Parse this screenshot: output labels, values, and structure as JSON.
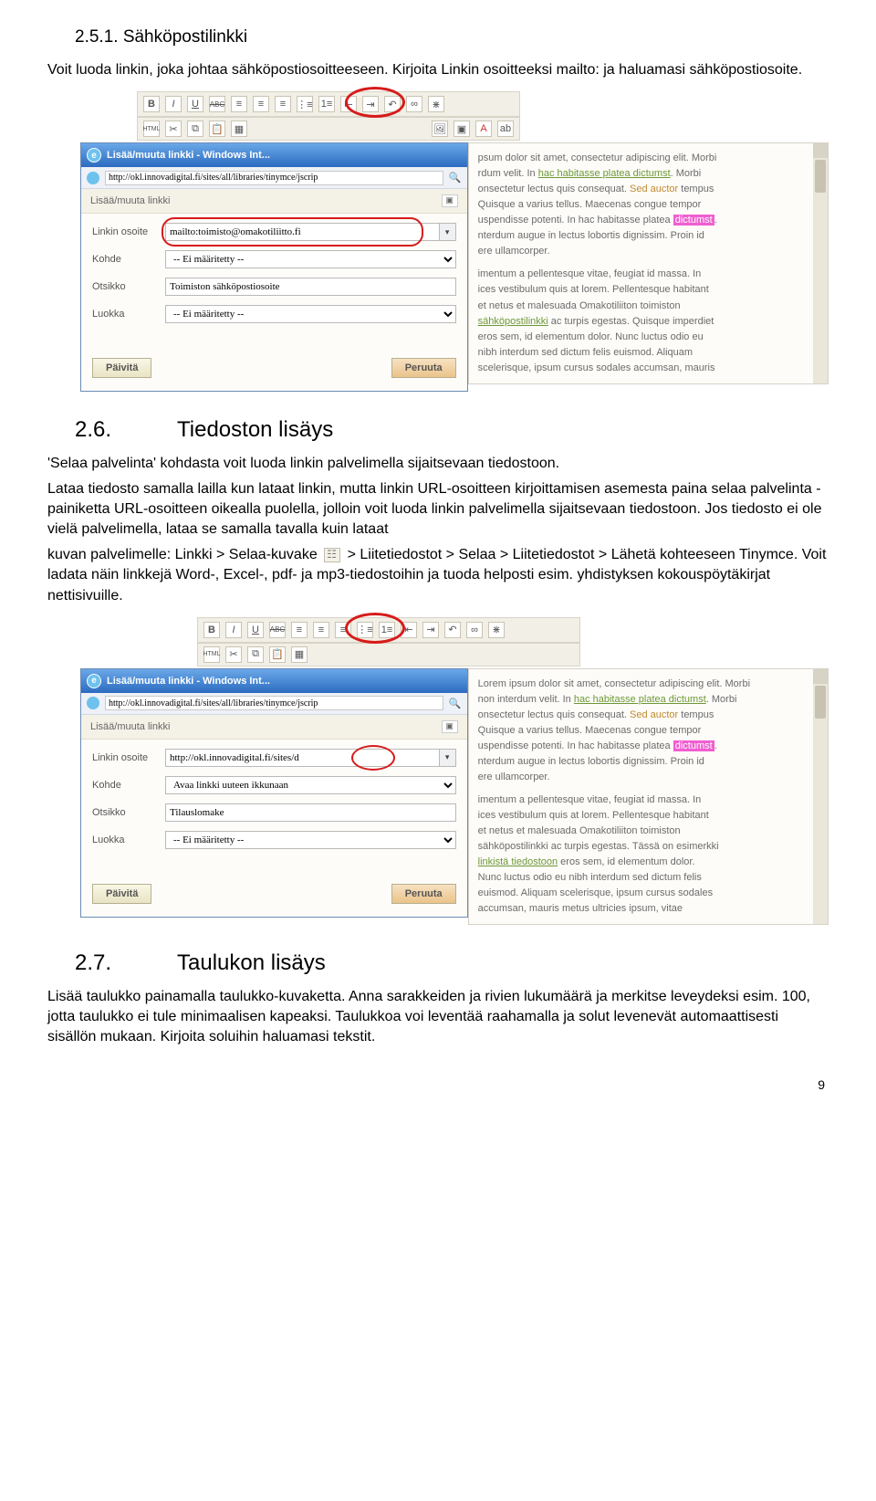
{
  "sec251": {
    "heading": "2.5.1. Sähköpostilinkki",
    "p": "Voit luoda linkin, joka johtaa sähköpostiosoitteeseen. Kirjoita Linkin osoitteeksi mailto: ja haluamasi sähköpostiosoite."
  },
  "sec26": {
    "num": "2.6.",
    "title": "Tiedoston lisäys",
    "p1": "'Selaa palvelinta' kohdasta voit luoda linkin palvelimella sijaitsevaan tiedostoon.",
    "p2": "Lataa tiedosto samalla lailla kun lataat linkin, mutta linkin URL-osoitteen kirjoittamisen asemesta paina selaa palvelinta -painiketta URL-osoitteen oikealla puolella, jolloin voit luoda linkin palvelimella sijaitsevaan tiedostoon. Jos tiedosto ei ole vielä palvelimella, lataa se samalla tavalla kuin lataat",
    "p3a": "kuvan palvelimelle: Linkki > Selaa-kuvake ",
    "p3b": " > Liitetiedostot > Selaa > Liitetiedostot > Lähetä kohteeseen Tinymce. Voit ladata näin linkkejä Word-, Excel-, pdf- ja mp3-tiedostoihin ja tuoda helposti esim. yhdistyksen kokouspöytäkirjat nettisivuille."
  },
  "sec27": {
    "num": "2.7.",
    "title": "Taulukon lisäys",
    "p": "Lisää taulukko painamalla taulukko-kuvaketta. Anna sarakkeiden ja rivien lukumäärä ja merkitse leveydeksi esim. 100, jotta taulukko ei tule minimaalisen kapeaksi. Taulukkoa voi leventää raahamalla ja solut levenevät automaattisesti sisällön mukaan. Kirjoita soluihin haluamasi tekstit."
  },
  "fig_dialog": {
    "win_title": "Lisää/muuta linkki - Windows Int...",
    "url_prefix": "http://okl.innovadigital.fi/sites/all/libraries/tinymce/jscrip",
    "tab": "Lisää/muuta linkki",
    "labels": {
      "url": "Linkin osoite",
      "kohde": "Kohde",
      "otsikko": "Otsikko",
      "luokka": "Luokka"
    },
    "ei_maar": "-- Ei määritetty --",
    "avaa_uuteen": "Avaa linkki uuteen ikkunaan",
    "update": "Päivitä",
    "cancel": "Peruuta"
  },
  "fig1": {
    "url_value": "mailto:toimisto@omakotiliitto.fi",
    "otsikko": "Toimiston sähköpostiosoite"
  },
  "fig2": {
    "url_value": "http://okl.innovadigital.fi/sites/d",
    "otsikko": "Tilauslomake"
  },
  "lorem": {
    "l1a": "psum dolor sit amet, consectetur adipiscing elit. Morbi",
    "l1b": "rdum velit. In ",
    "hac": "hac habitasse platea dictumst",
    "l1c": ". Morbi",
    "l2": "onsectetur lectus quis consequat. ",
    "sed": "Sed auctor",
    "l2b": " tempus",
    "l3": "Quisque a varius tellus. Maecenas congue tempor",
    "l4a": "uspendisse potenti. In hac habitasse platea ",
    "dict": "dictumst",
    "l4b": ".",
    "l5": "nterdum augue in lectus lobortis dignissim. Proin id",
    "l6": "ere ullamcorper.",
    "l7": "imentum a pellentesque vitae, feugiat id massa. In",
    "l8": "ices vestibulum quis at lorem. Pellentesque habitant",
    "l9": "et netus et malesuada Omakotiliiton toimiston",
    "l10": "sähköpostilinkki ac turpis egestas. Quisque imperdiet",
    "l11": "eros sem, id elementum dolor. Nunc luctus odio eu",
    "l12": "nibh interdum sed dictum felis euismod. Aliquam",
    "l13": "scelerisque, ipsum cursus sodales accumsan, mauris",
    "r0": "Lorem ipsum dolor sit amet, consectetur adipiscing elit. Morbi",
    "r1": "non interdum velit. In ",
    "r9b": "sähköpostilinkki ac turpis egestas. Tässä on esimerkki",
    "r10": "linkistä tiedostoon eros sem, id elementum dolor.",
    "r11": "Nunc luctus odio eu nibh interdum sed dictum felis",
    "r12": "euismod. Aliquam scelerisque, ipsum cursus sodales",
    "r13": "accumsan, mauris metus ultricies ipsum, vitae"
  },
  "toolbar": {
    "b": "B",
    "i": "I",
    "u": "U",
    "abc": "ABC",
    "html": "HTML"
  },
  "page_number": "9"
}
